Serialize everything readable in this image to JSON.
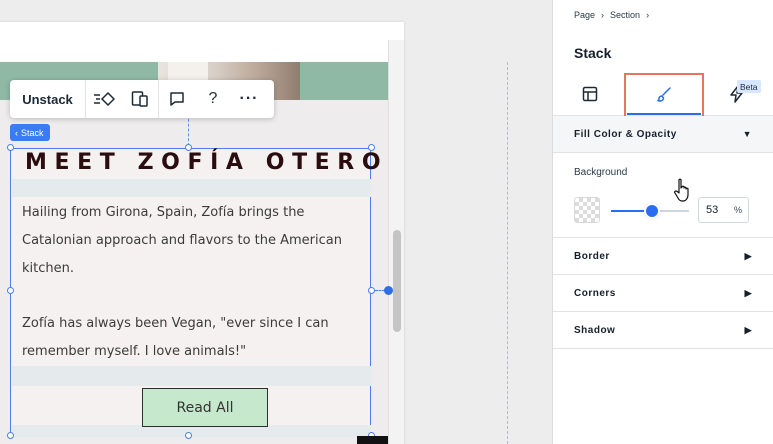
{
  "canvas": {
    "stack_tag": "Stack",
    "toolbar": {
      "unstack_label": "Unstack"
    },
    "content": {
      "title": "MEET ZOFÍA OTERO",
      "paragraph1": "Hailing from Girona, Spain, Zofía brings the Catalonian approach and flavors to the American kitchen.",
      "paragraph2": "Zofía has always been Vegan, \"ever since I can remember myself. I love animals!\"",
      "button_label": "Read All"
    }
  },
  "panel": {
    "breadcrumb": [
      "Page",
      "Section"
    ],
    "title": "Stack",
    "tabs": [
      {
        "name": "layout",
        "icon": "layout-icon"
      },
      {
        "name": "design",
        "icon": "brush-icon",
        "active": true
      },
      {
        "name": "interactions",
        "icon": "lightning-icon",
        "badge": "Beta"
      }
    ],
    "fill": {
      "heading": "Fill Color & Opacity",
      "background_label": "Background",
      "opacity_value": "53",
      "opacity_unit": "%",
      "opacity_fraction": 0.53
    },
    "sections": [
      "Border",
      "Corners",
      "Shadow"
    ]
  },
  "colors": {
    "accent": "#2b6df0",
    "highlight": "#e4765f",
    "button_fill": "#c6e8cd",
    "title_text": "#2b0d10"
  }
}
